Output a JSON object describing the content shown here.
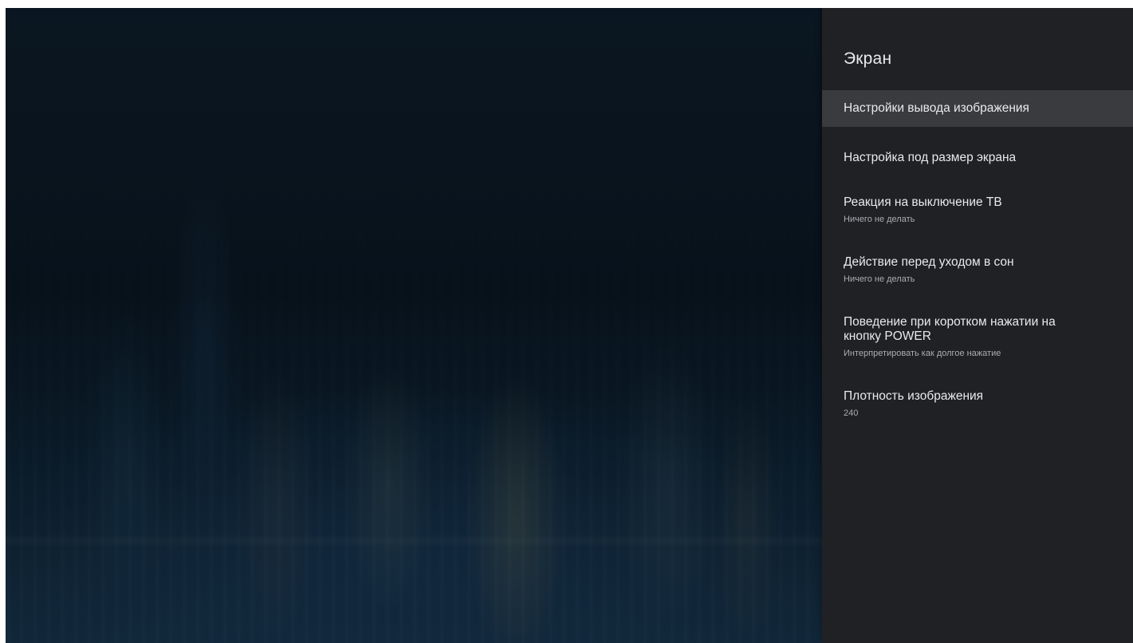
{
  "screen": {
    "title": "Экран",
    "items": [
      {
        "label": "Настройки вывода изображения",
        "value": null,
        "focused": true
      },
      {
        "label": "Настройка под размер экрана",
        "value": null,
        "focused": false
      },
      {
        "label": "Реакция на выключение ТВ",
        "value": "Ничего не делать",
        "focused": false
      },
      {
        "label": "Действие перед уходом в сон",
        "value": "Ничего не делать",
        "focused": false
      },
      {
        "label": "Поведение при коротком нажатии на кнопку POWER",
        "value": "Интерпретировать как долгое нажатие",
        "focused": false
      },
      {
        "label": "Плотность изображения",
        "value": "240",
        "focused": false
      }
    ]
  },
  "colors": {
    "panel_background": "#202124",
    "focused_row": "#3a3b3e",
    "primary_text": "#e8eaed",
    "secondary_text": "#a9acb1"
  }
}
